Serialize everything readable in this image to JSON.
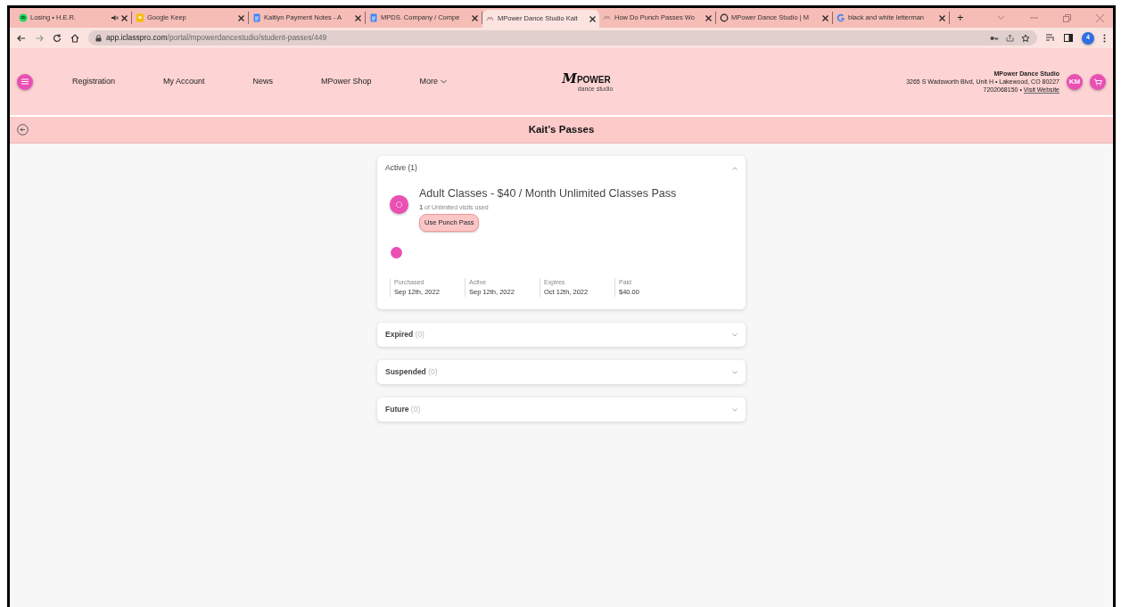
{
  "browser": {
    "tabs": [
      {
        "title": "Losing • H.E.R.",
        "kind": "music",
        "muted": true,
        "selected": false
      },
      {
        "title": "Google Keep",
        "kind": "keep",
        "muted": false,
        "selected": false
      },
      {
        "title": "Kaitlyn Payment Notes - A",
        "kind": "doc",
        "muted": false,
        "selected": false
      },
      {
        "title": "MPDS. Company / Compe",
        "kind": "doc",
        "muted": false,
        "selected": false
      },
      {
        "title": "MPower Dance Studio Kait",
        "kind": "site",
        "muted": false,
        "selected": true
      },
      {
        "title": "How Do Punch Passes Wo",
        "kind": "site",
        "muted": false,
        "selected": false
      },
      {
        "title": "MPower Dance Studio | M",
        "kind": "ring",
        "muted": false,
        "selected": false
      },
      {
        "title": "black and white letterman",
        "kind": "google",
        "muted": false,
        "selected": false
      }
    ],
    "new_tab": "+",
    "url_host": "app.iclasspro.com",
    "url_path": "/portal/mpowerdancestudio/student-passes/449",
    "profile": "4"
  },
  "site_header": {
    "nav": [
      "Registration",
      "My Account",
      "News",
      "MPower Shop",
      "More"
    ],
    "logo": {
      "mark": "M",
      "word": "POWER",
      "tagline": "dance studio"
    },
    "studio_name": "MPower Dance Studio",
    "address": "3265 S Wadsworth Blvd, Unit H • Lakewood, CO 80227",
    "phone": "7202068150 •",
    "website": "Visit Website",
    "user_initials": "KM"
  },
  "page_title": "Kait’s Passes",
  "sections": [
    {
      "label": "Active",
      "count": "(1)",
      "expanded": true,
      "passes": [
        {
          "name": "Adult Classes - $40 / Month Unlimited Classes Pass",
          "used": "1",
          "usage": "of Unlimited visits used",
          "button": "Use Punch Pass",
          "details": [
            {
              "label": "Purchased",
              "value": "Sep 12th, 2022"
            },
            {
              "label": "Active",
              "value": "Sep 12th, 2022"
            },
            {
              "label": "Expires",
              "value": "Oct 12th, 2022"
            },
            {
              "label": "Paid",
              "value": "$40.00"
            }
          ]
        }
      ]
    },
    {
      "label": "Expired",
      "count": "(0)",
      "expanded": false
    },
    {
      "label": "Suspended",
      "count": "(0)",
      "expanded": false
    },
    {
      "label": "Future",
      "count": "(0)",
      "expanded": false
    }
  ]
}
